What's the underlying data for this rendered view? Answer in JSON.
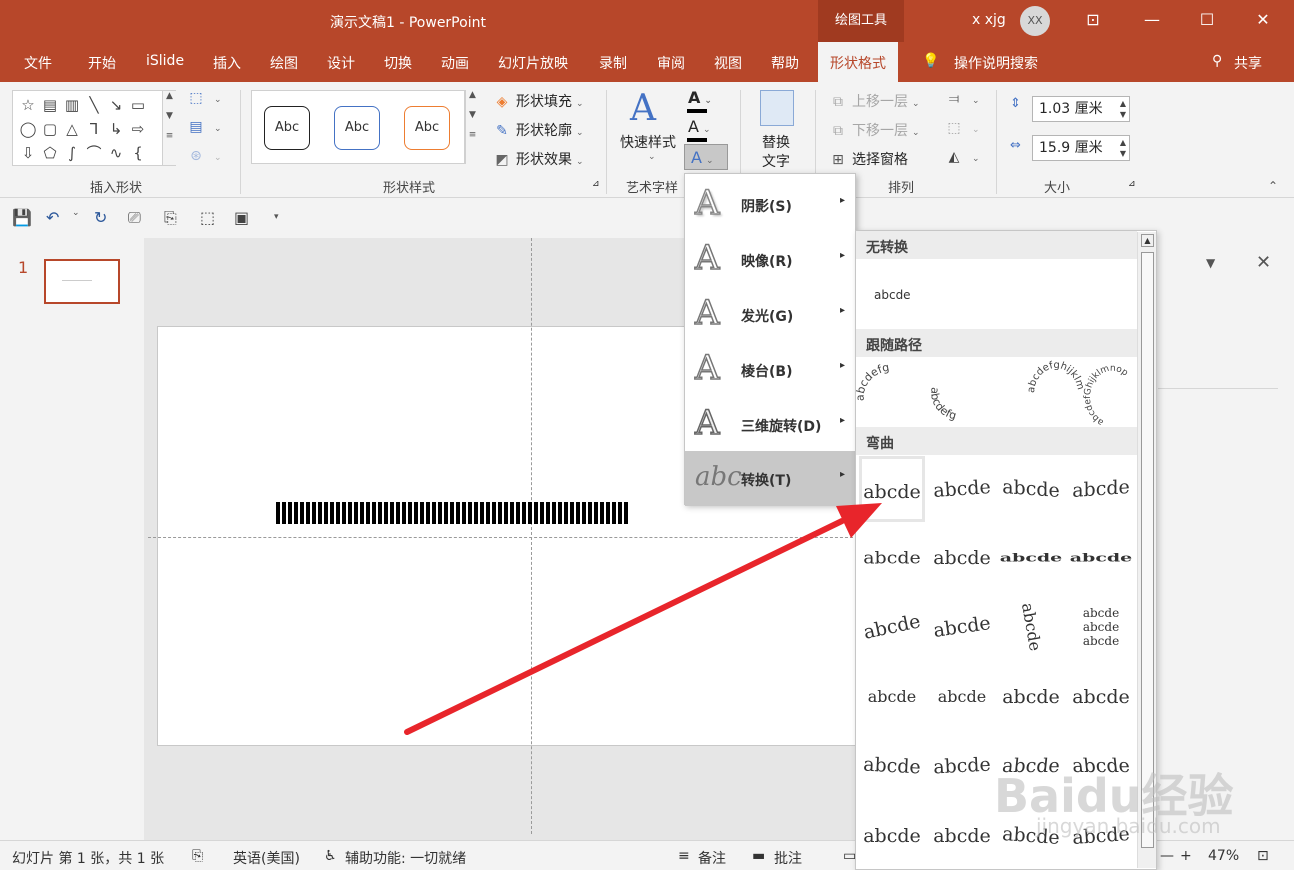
{
  "titlebar": {
    "doc_title": "演示文稿1  -  PowerPoint",
    "context_tools": "绘图工具",
    "user_name": "x xjg",
    "avatar_initials": "XX"
  },
  "tabs": [
    {
      "label": "文件"
    },
    {
      "label": "开始"
    },
    {
      "label": "iSlide"
    },
    {
      "label": "插入"
    },
    {
      "label": "绘图"
    },
    {
      "label": "设计"
    },
    {
      "label": "切换"
    },
    {
      "label": "动画"
    },
    {
      "label": "幻灯片放映"
    },
    {
      "label": "录制"
    },
    {
      "label": "审阅"
    },
    {
      "label": "视图"
    },
    {
      "label": "帮助"
    },
    {
      "label": "形状格式",
      "active": true
    }
  ],
  "tell_me": "操作说明搜索",
  "share": "共享",
  "ribbon": {
    "insert_shapes": "插入形状",
    "shape_styles": "形状样式",
    "abc_samples": [
      "Abc",
      "Abc",
      "Abc"
    ],
    "fill": "形状填充",
    "outline": "形状轮廓",
    "effects": "形状效果",
    "quick_styles": "快速样式",
    "wordart": "艺术字样",
    "alt_text_line1": "替换",
    "alt_text_line2": "文字",
    "bring_forward": "上移一层",
    "send_backward": "下移一层",
    "selection_pane": "选择窗格",
    "arrange": "排列",
    "height": "1.03 厘米",
    "width": "15.9 厘米",
    "size": "大小"
  },
  "slide_number": "1",
  "effects_menu": [
    {
      "label": "阴影(S)"
    },
    {
      "label": "映像(R)"
    },
    {
      "label": "发光(G)"
    },
    {
      "label": "棱台(B)"
    },
    {
      "label": "三维旋转(D)"
    },
    {
      "label": "转换(T)",
      "selected": true
    }
  ],
  "transform_gallery": {
    "no_transform": "无转换",
    "no_transform_sample": "abcde",
    "follow_path": "跟随路径",
    "path_samples": [
      "abcdefg",
      "abcdefg",
      "abcdefghijklm",
      "abcdefGhijklmnop"
    ],
    "warp": "弯曲",
    "warp_sample": "abcde"
  },
  "statusbar": {
    "slide_info": "幻灯片 第 1 张，共 1 张",
    "language": "英语(美国)",
    "accessibility": "辅助功能: 一切就绪",
    "notes": "备注",
    "comments": "批注",
    "zoom": "47%"
  },
  "watermark": {
    "brand": "Baidu经验",
    "url": "jingyan.baidu.com"
  },
  "colors": {
    "accent": "#b7472a",
    "arrow": "#e8252b"
  }
}
